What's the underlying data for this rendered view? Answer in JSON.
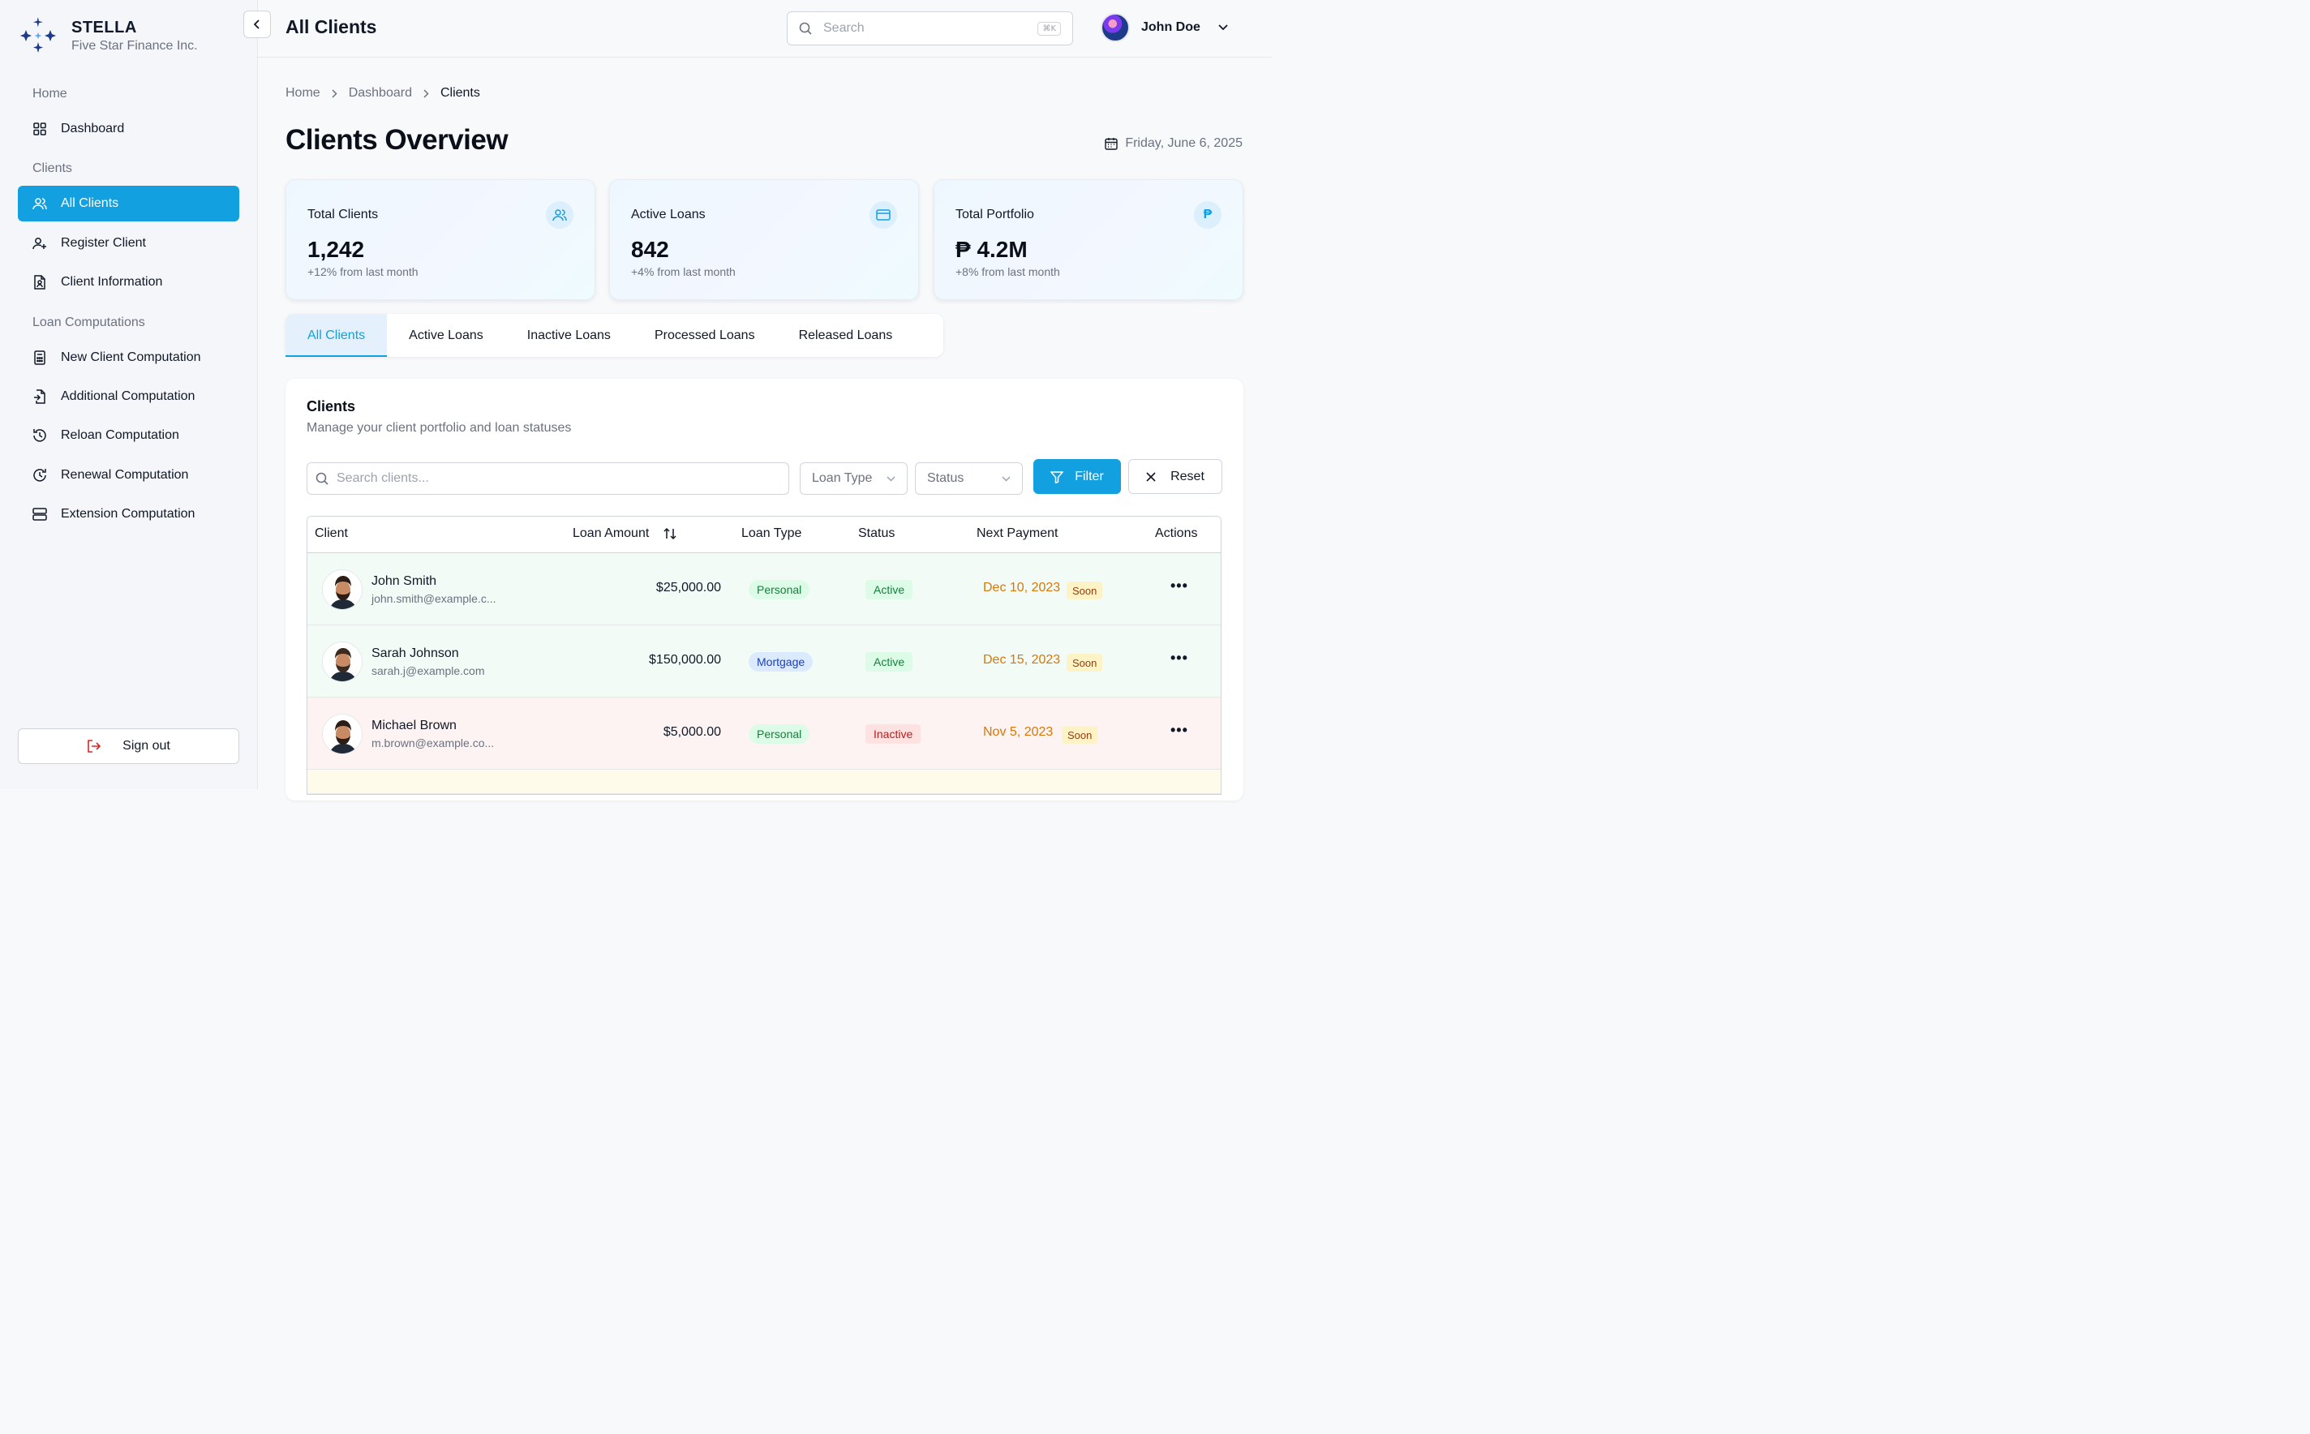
{
  "brand": {
    "name": "STELLA",
    "company": "Five Star Finance Inc."
  },
  "sidebar": {
    "sections": [
      "Home",
      "Clients",
      "Loan Computations"
    ],
    "items": [
      {
        "label": "Dashboard",
        "icon": "grid-icon"
      },
      {
        "label": "All Clients",
        "icon": "users-icon",
        "active": true
      },
      {
        "label": "Register Client",
        "icon": "user-plus-icon"
      },
      {
        "label": "Client Information",
        "icon": "file-user-icon"
      },
      {
        "label": "New Client Computation",
        "icon": "calculator-icon"
      },
      {
        "label": "Additional Computation",
        "icon": "file-plus-icon"
      },
      {
        "label": "Reloan Computation",
        "icon": "history-icon"
      },
      {
        "label": "Renewal Computation",
        "icon": "clock-refresh-icon"
      },
      {
        "label": "Extension Computation",
        "icon": "server-icon"
      }
    ],
    "signout": "Sign out"
  },
  "header": {
    "title": "All Clients",
    "search_placeholder": "Search",
    "shortcut": "⌘K",
    "user_name": "John Doe"
  },
  "breadcrumb": [
    "Home",
    "Dashboard",
    "Clients"
  ],
  "page": {
    "title": "Clients Overview",
    "date": "Friday, June 6, 2025"
  },
  "stats": [
    {
      "label": "Total Clients",
      "value": "1,242",
      "delta": "+12% from last month",
      "icon": "users-icon"
    },
    {
      "label": "Active Loans",
      "value": "842",
      "delta": "+4% from last month",
      "icon": "credit-card-icon"
    },
    {
      "label": "Total Portfolio",
      "value": "₱ 4.2M",
      "delta": "+8% from last month",
      "icon": "peso-icon"
    }
  ],
  "tabs": [
    "All Clients",
    "Active Loans",
    "Inactive Loans",
    "Processed Loans",
    "Released Loans"
  ],
  "clients_panel": {
    "title": "Clients",
    "subtitle": "Manage your client portfolio and loan statuses",
    "search_placeholder": "Search clients...",
    "loan_type_select": "Loan Type",
    "status_select": "Status",
    "filter_label": "Filter",
    "reset_label": "Reset",
    "columns": [
      "Client",
      "Loan Amount",
      "Loan Type",
      "Status",
      "Next Payment",
      "Actions"
    ],
    "rows": [
      {
        "name": "John Smith",
        "email": "john.smith@example.c...",
        "amount": "$25,000.00",
        "loan_type": "Personal",
        "status": "Active",
        "next_payment": "Dec 10, 2023",
        "badge": "Soon"
      },
      {
        "name": "Sarah Johnson",
        "email": "sarah.j@example.com",
        "amount": "$150,000.00",
        "loan_type": "Mortgage",
        "status": "Active",
        "next_payment": "Dec 15, 2023",
        "badge": "Soon"
      },
      {
        "name": "Michael Brown",
        "email": "m.brown@example.co...",
        "amount": "$5,000.00",
        "loan_type": "Personal",
        "status": "Inactive",
        "next_payment": "Nov 5, 2023",
        "badge": "Soon"
      }
    ],
    "actions_glyph": "•••"
  },
  "colors": {
    "accent": "#12a0e0",
    "brand_star": "#1e3a8a",
    "due": "#d97706"
  }
}
